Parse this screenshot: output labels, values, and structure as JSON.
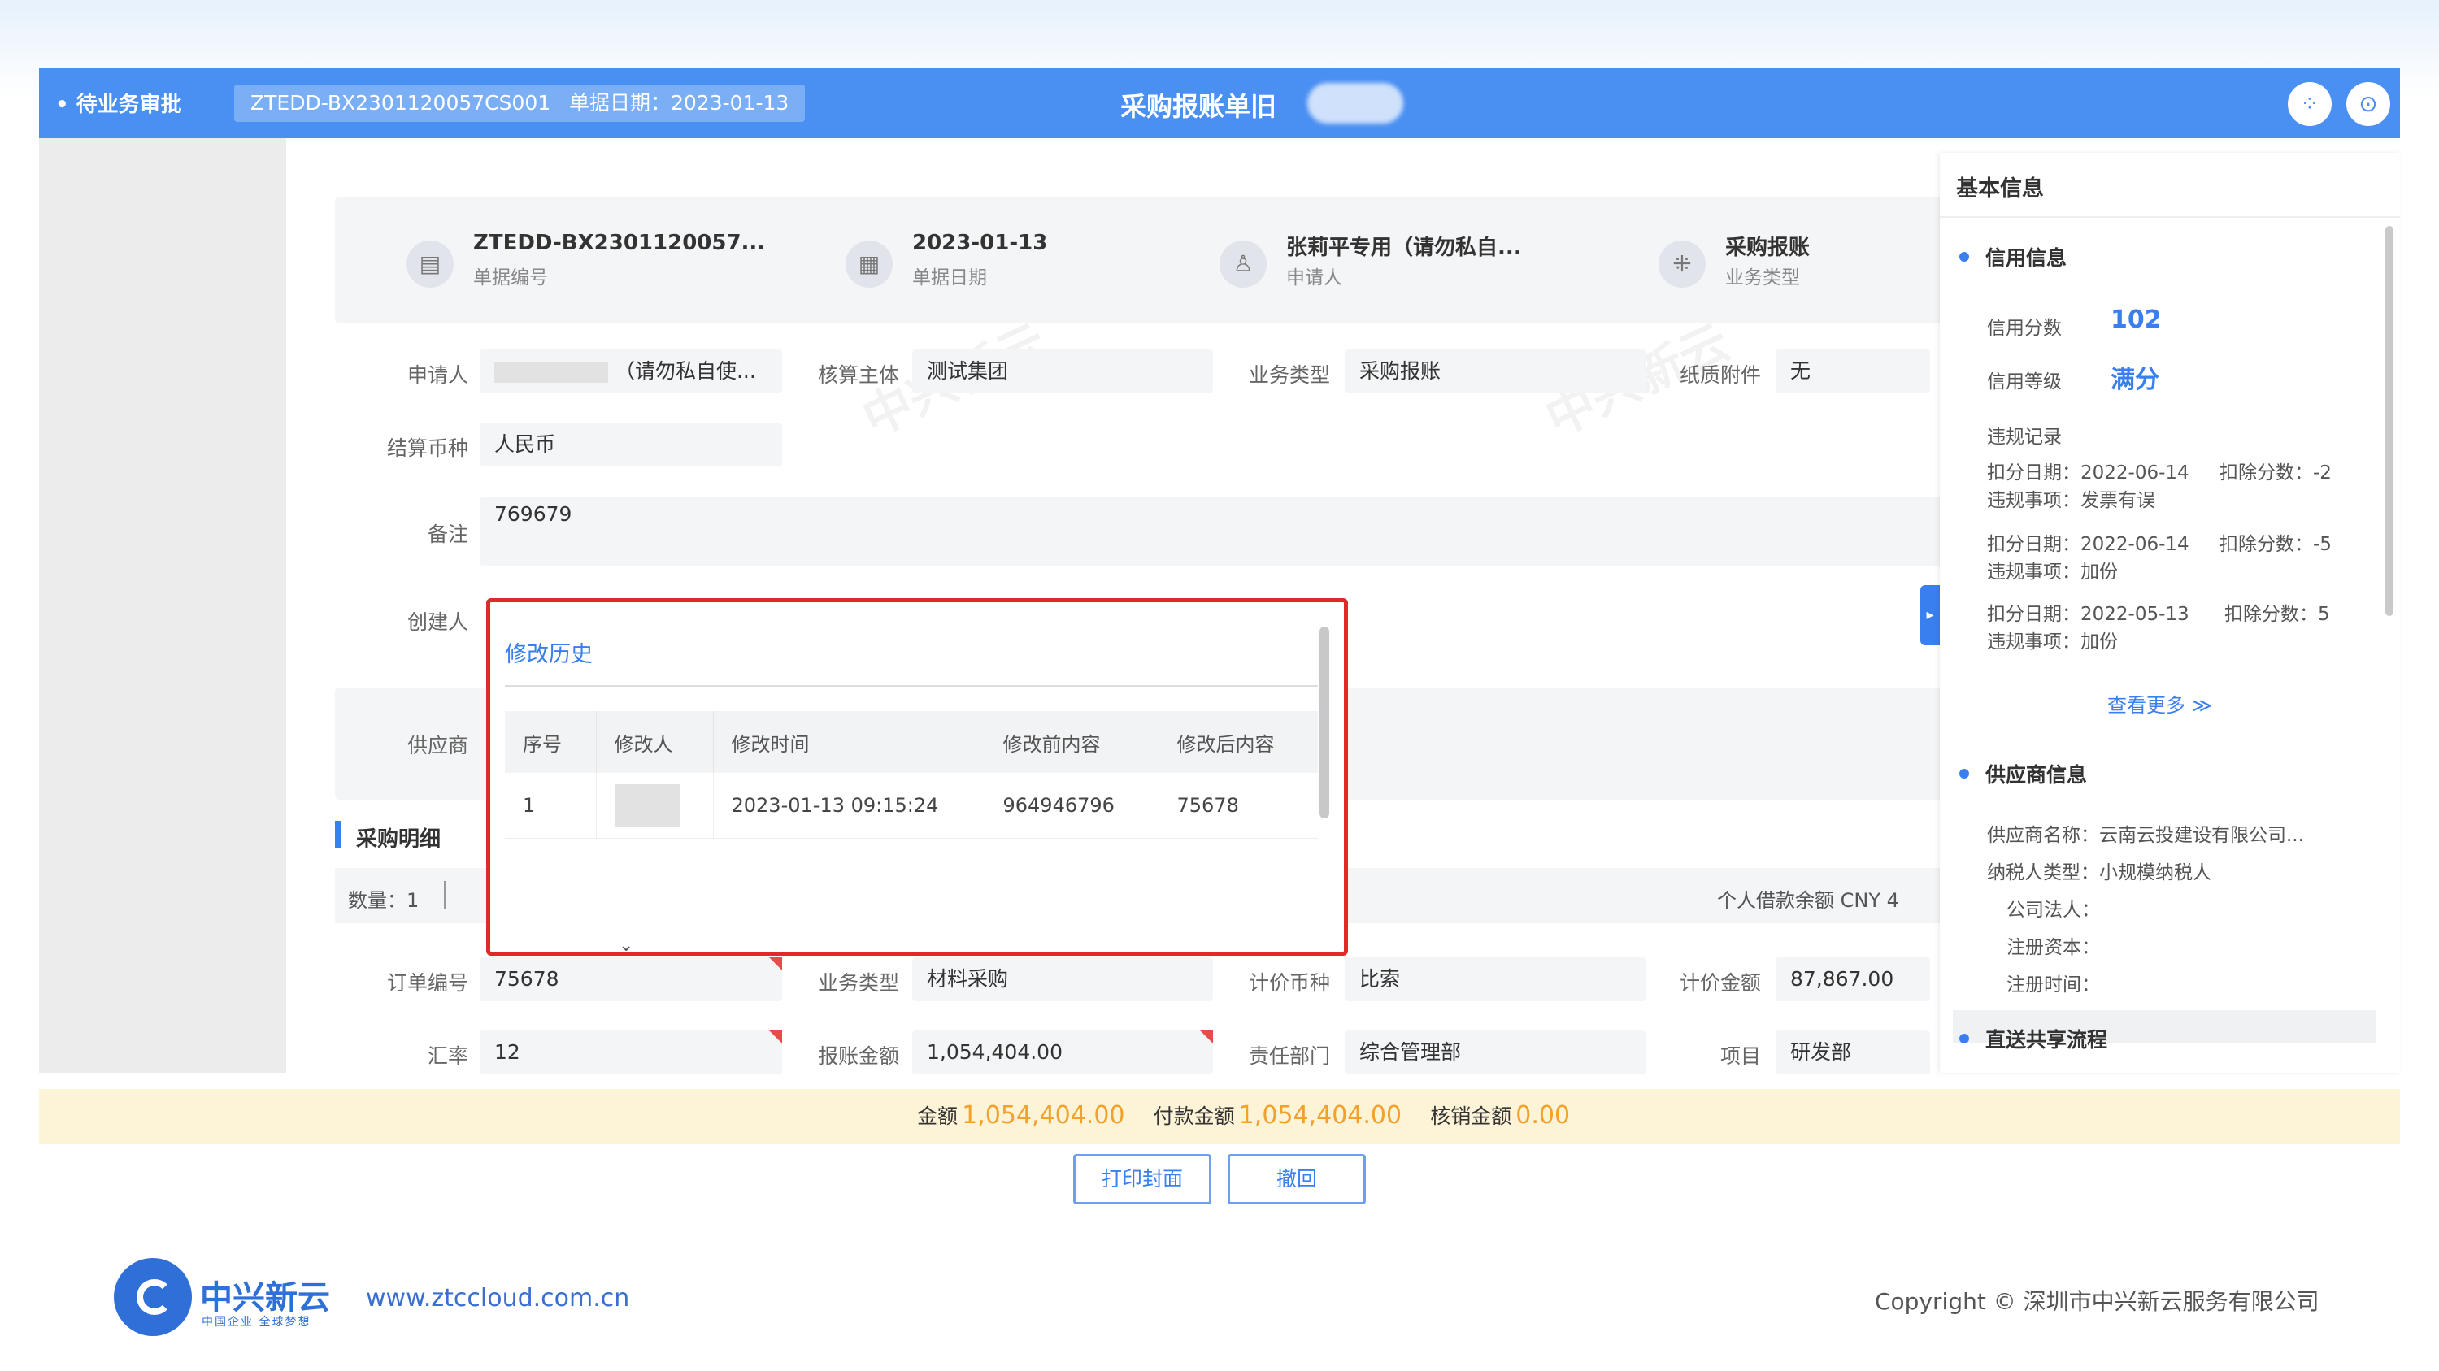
{
  "topbar": {
    "section": "• 待业务审批",
    "doc_no": "ZTEDD-BX2301120057CS001",
    "date_chip": "单据日期：2023-01-13",
    "title": "采购报账单旧",
    "icon_left": "grid-icon",
    "icon_right": "search-icon"
  },
  "header_cards": [
    {
      "icon": "document-icon",
      "value": "ZTEDD-BX2301120057...",
      "label": "单据编号"
    },
    {
      "icon": "calendar-icon",
      "value": "2023-01-13",
      "label": "单据日期"
    },
    {
      "icon": "user-icon",
      "value": "张莉平专用（请勿私自...",
      "label": "申请人"
    },
    {
      "icon": "apps-icon",
      "value": "采购报账",
      "label": "业务类型"
    }
  ],
  "form": {
    "applicant_label": "申请人",
    "applicant_value": "（请勿私自使...",
    "entity_label": "核算主体",
    "entity_value": "测试集团",
    "biz_type_label": "业务类型",
    "biz_type_value": "采购报账",
    "paper_label": "纸质附件",
    "paper_value": "无",
    "currency_label": "结算币种",
    "currency_value": "人民币",
    "remark_label": "备注",
    "remark_value": "769679",
    "creator_label": "创建人",
    "supplier_label": "供应商"
  },
  "purchase": {
    "section_title": "采购明细",
    "count_label": "数量：1",
    "balance_label": "个人借款余额 CNY 4",
    "order_label": "订单编号",
    "order_value": "75678",
    "biz_label": "业务类型",
    "biz_value": "材料采购",
    "price_currency_label": "计价币种",
    "price_currency_value": "比索",
    "price_amount_label": "计价金额",
    "price_amount_value": "87,867.00",
    "rate_label": "汇率",
    "rate_value": "12",
    "reimb_label": "报账金额",
    "reimb_value": "1,054,404.00",
    "dept_label": "责任部门",
    "dept_value": "综合管理部",
    "project_label": "项目",
    "project_value": "研发部"
  },
  "modal": {
    "title": "修改历史",
    "columns": [
      "序号",
      "修改人",
      "修改时间",
      "修改前内容",
      "修改后内容"
    ],
    "rows": [
      {
        "seq": "1",
        "time": "2023-01-13 09:15:24",
        "before": "964946796",
        "after": "75678"
      }
    ]
  },
  "right_panel": {
    "title": "基本信息",
    "credit_title": "信用信息",
    "score_label": "信用分数",
    "score_value": "102",
    "grade_label": "信用等级",
    "grade_value": "满分",
    "violation_title": "违规记录",
    "violations": [
      {
        "date": "扣分日期：2022-06-14",
        "deduct": "扣除分数：-2",
        "item": "违规事项：发票有误"
      },
      {
        "date": "扣分日期：2022-06-14",
        "deduct": "扣除分数：-5",
        "item": "违规事项：加份"
      },
      {
        "date": "扣分日期：2022-05-13",
        "deduct": "扣除分数：5",
        "item": "违规事项：加份"
      }
    ],
    "more": "查看更多 ≫",
    "supplier_title": "供应商信息",
    "supplier_name": "供应商名称：云南云投建设有限公司...",
    "taxpayer": "纳税人类型：小规模纳税人",
    "legal": "公司法人：",
    "capital": "注册资本：",
    "reg_time": "注册时间：",
    "next_title": "直送共享流程"
  },
  "summary": {
    "amount_label": "金额",
    "amount_value": "1,054,404.00",
    "paid_label": "付款金额",
    "paid_value": "1,054,404.00",
    "verify_label": "核销金额",
    "verify_value": "0.00"
  },
  "buttons": {
    "print": "打印封面",
    "withdraw": "撤回"
  },
  "footer": {
    "brand": "中兴新云",
    "brand_sub": "中国企业 全球梦想",
    "url": "www.ztccloud.com.cn",
    "copyright": "Copyright © 深圳市中兴新云服务有限公司"
  },
  "colors": {
    "primary": "#4a8ff2",
    "accent": "#3a7ff0",
    "highlight_border": "#e02a2a",
    "amount": "#f2a12a",
    "summary_bg": "#fdf3d7"
  }
}
